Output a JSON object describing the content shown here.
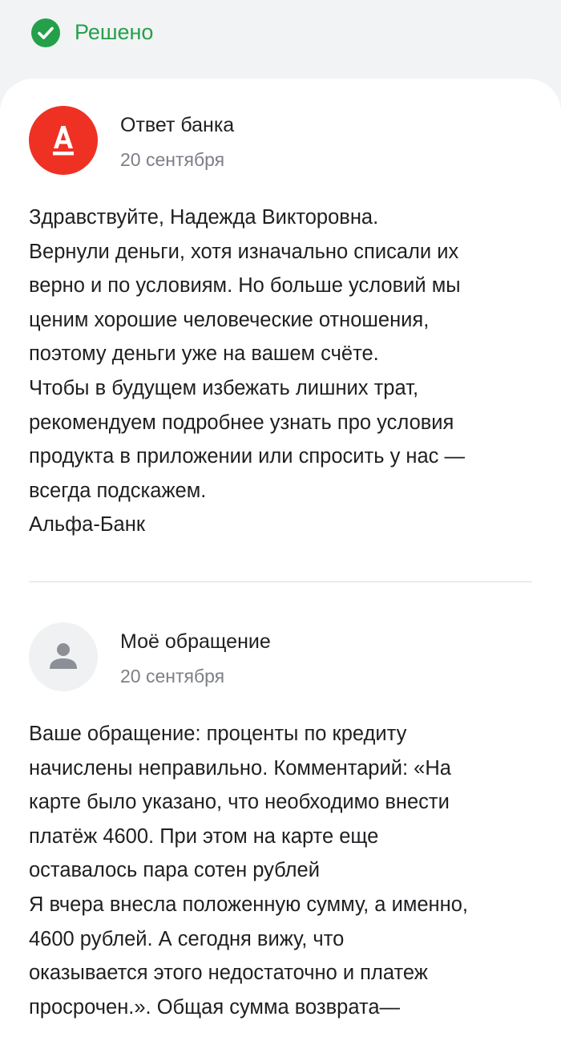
{
  "status": {
    "label": "Решено",
    "icon": "check-circle-icon",
    "color": "#25a04a"
  },
  "messages": [
    {
      "author": "Ответ банка",
      "date": "20 сентября",
      "avatar": {
        "icon": "alfa-bank-logo",
        "background": "#ef3124"
      },
      "lines": [
        "Здравствуйте, Надежда Викторовна.",
        "Вернули деньги, хотя изначально списали их",
        "верно и по условиям. Но больше условий мы",
        "ценим хорошие человеческие отношения,",
        "поэтому деньги уже на вашем счёте.",
        "Чтобы в будущем избежать лишних трат,",
        "рекомендуем подробнее узнать про условия",
        "продукта в приложении или спросить у нас —",
        "всегда подскажем.",
        "Альфа-Банк"
      ]
    },
    {
      "author": "Моё обращение",
      "date": "20 сентября",
      "avatar": {
        "icon": "user-icon",
        "background": "#f0f1f3"
      },
      "lines": [
        "Ваше обращение: проценты по кредиту",
        "начислены неправильно. Комментарий: «На",
        "карте было указано, что необходимо внести",
        "платёж 4600. При этом на карте еще",
        "оставалось пара сотен рублей",
        "Я вчера внесла положенную сумму, а именно,",
        "4600 рублей. А сегодня вижу, что",
        "оказывается этого недостаточно и платеж",
        "просрочен.». Общая сумма возврата—"
      ]
    }
  ]
}
